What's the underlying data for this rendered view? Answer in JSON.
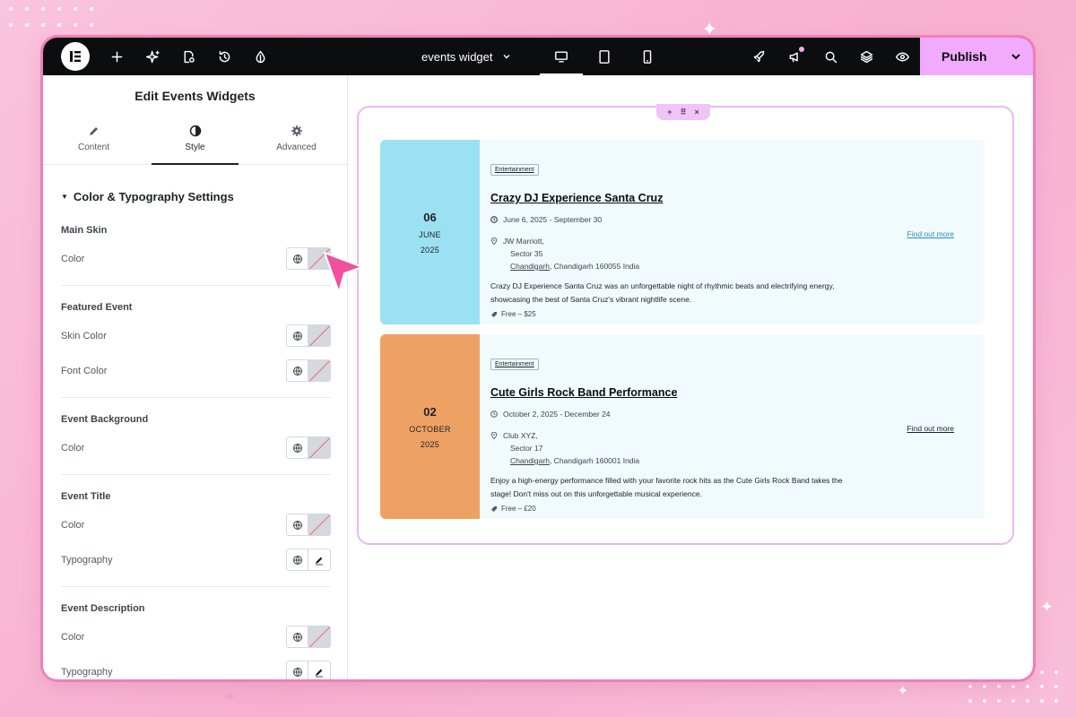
{
  "topbar": {
    "doc_title": "events widget",
    "publish_label": "Publish",
    "left_icons": [
      "plus-icon",
      "sparkle-ai-icon",
      "page-settings-icon",
      "history-icon",
      "theme-style-icon"
    ],
    "devices": [
      "desktop-icon",
      "tablet-icon",
      "mobile-icon"
    ],
    "right_icons": [
      "rocket-icon",
      "megaphone-icon",
      "search-icon",
      "layers-icon",
      "preview-eye-icon"
    ]
  },
  "panel": {
    "title": "Edit Events Widgets",
    "tabs": [
      {
        "label": "Content",
        "icon": "pencil-icon"
      },
      {
        "label": "Style",
        "icon": "contrast-icon"
      },
      {
        "label": "Advanced",
        "icon": "gear-icon"
      }
    ],
    "section_title": "Color & Typography Settings",
    "groups": [
      {
        "title": "Main Skin",
        "rows": [
          {
            "label": "Color",
            "control": "color"
          }
        ]
      },
      {
        "title": "Featured Event",
        "rows": [
          {
            "label": "Skin Color",
            "control": "color"
          },
          {
            "label": "Font Color",
            "control": "color"
          }
        ]
      },
      {
        "title": "Event Background",
        "rows": [
          {
            "label": "Color",
            "control": "color"
          }
        ]
      },
      {
        "title": "Event Title",
        "rows": [
          {
            "label": "Color",
            "control": "color"
          },
          {
            "label": "Typography",
            "control": "typography"
          }
        ]
      },
      {
        "title": "Event Description",
        "rows": [
          {
            "label": "Color",
            "control": "color"
          },
          {
            "label": "Typography",
            "control": "typography"
          }
        ]
      }
    ]
  },
  "canvas": {
    "handle": {
      "add": "+",
      "move": "⠿",
      "close": "×"
    },
    "events": [
      {
        "day": "06",
        "month": "JUNE",
        "year": "2025",
        "date_color": "#9be1f3",
        "category": "Entertainment",
        "title": "Crazy DJ Experience Santa Cruz",
        "dates": "June 6, 2025 - September 30",
        "venue": "JW Marriott,",
        "street": "Sector 35",
        "city": "Chandigarh",
        "city_rest": ", Chandigarh 160055 India",
        "description": "Crazy DJ Experience Santa Cruz was an unforgettable night of rhythmic beats and electrifying energy, showcasing the best of Santa Cruz's vibrant nightlife scene.",
        "price": "Free – $25",
        "link": "Find out more",
        "link_color": "#2a8fc7"
      },
      {
        "day": "02",
        "month": "OCTOBER",
        "year": "2025",
        "date_color": "#eda264",
        "category": "Entertainment",
        "title": "Cute Girls Rock Band Performance",
        "dates": "October 2, 2025 - December 24",
        "venue": "Club XYZ,",
        "street": "Sector 17",
        "city": "Chandigarh",
        "city_rest": ", Chandigarh 160001 India",
        "description": "Enjoy a high-energy performance filled with your favorite rock hits as the Cute Girls Rock Band takes the stage! Don't miss out on this unforgettable musical experience.",
        "price": "Free – £20",
        "link": "Find out more",
        "link_color": "#1f2124"
      }
    ]
  },
  "colors": {
    "background": "#f9bcd7",
    "frame": "#f07fb8",
    "publish_bg": "#f0abfc",
    "topbar": "#0c0d0e",
    "pointer": "#f0509d"
  }
}
